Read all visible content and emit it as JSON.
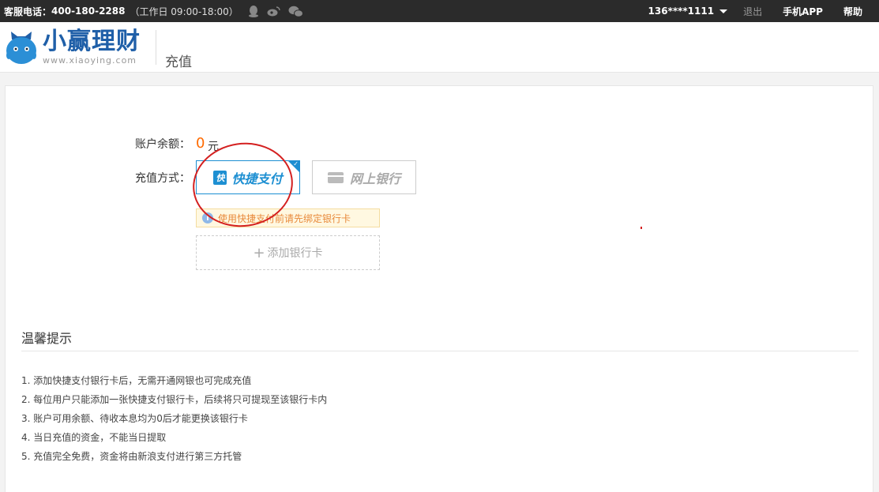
{
  "topbar": {
    "hotline_label": "客服电话：",
    "hotline_number": "400-180-2288",
    "hours": "（工作日 09:00-18:00）",
    "social_icons": [
      "qq-icon",
      "weibo-icon",
      "wechat-icon"
    ],
    "user": "136****1111",
    "logout": "退出",
    "app": "手机APP",
    "help": "帮助"
  },
  "header": {
    "logo_title": "小赢理财",
    "logo_domain": "www.xiaoying.com",
    "page_title": "充值"
  },
  "recharge": {
    "balance_label": "账户余额：",
    "balance_value": "0",
    "balance_unit": "元",
    "method_label": "充值方式：",
    "quick_badge": "快",
    "quick_pay": "快捷支付",
    "online_bank": "网上银行",
    "notice": "使用快捷支付前请先绑定银行卡",
    "add_card": "添加银行卡"
  },
  "tips": {
    "title": "温馨提示",
    "items": [
      "1. 添加快捷支付银行卡后，无需开通网银也可完成充值",
      "2. 每位用户只能添加一张快捷支付银行卡，后续将只可提现至该银行卡内",
      "3. 账户可用余额、待收本息均为0后才能更换该银行卡",
      "4. 当日充值的资金，不能当日提取",
      "5. 充值完全免费，资金将由新浪支付进行第三方托管"
    ]
  },
  "colors": {
    "accent": "#1d8fd2",
    "balance": "#ff6a00",
    "annotation": "#d42020"
  }
}
